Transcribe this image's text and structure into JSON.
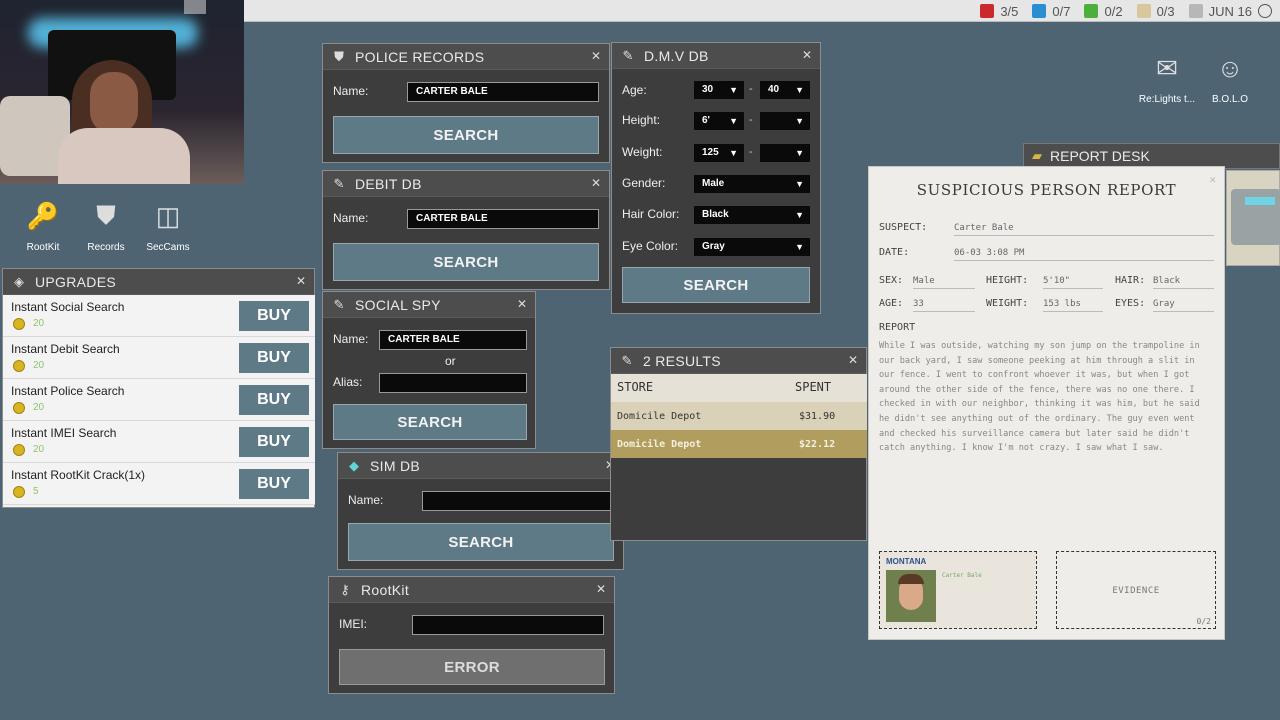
{
  "topbar": {
    "stats": [
      {
        "icon": "warrant-icon",
        "value": "3/5",
        "color": "#cc2a2a"
      },
      {
        "icon": "tablet-icon",
        "value": "0/7",
        "color": "#2b8ed1"
      },
      {
        "icon": "cash-icon",
        "value": "0/2",
        "color": "#4caf3c"
      },
      {
        "icon": "notes-icon",
        "value": "0/3",
        "color": "#d8c79a"
      },
      {
        "icon": "calendar-icon",
        "value": "JUN 16",
        "color": "#b7b7b7"
      }
    ]
  },
  "desktop": {
    "left_icons": [
      {
        "label": "RootKit",
        "icon": "usb-key-icon"
      },
      {
        "label": "Records",
        "icon": "badge-icon"
      },
      {
        "label": "SecCams",
        "icon": "camera-icon"
      }
    ],
    "right_icons": [
      {
        "label": "Re:Lights t...",
        "icon": "mail-icon"
      },
      {
        "label": "B.O.L.O",
        "icon": "bolo-icon"
      }
    ]
  },
  "upgrades": {
    "title": "UPGRADES",
    "buy_label": "BUY",
    "items": [
      {
        "name": "Instant Social Search",
        "price": "20"
      },
      {
        "name": "Instant Debit Search",
        "price": "20"
      },
      {
        "name": "Instant Police Search",
        "price": "20"
      },
      {
        "name": "Instant IMEI Search",
        "price": "20"
      },
      {
        "name": "Instant RootKit Crack(1x)",
        "price": "5"
      }
    ]
  },
  "police": {
    "title": "POLICE RECORDS",
    "name_label": "Name:",
    "name_value": "CARTER BALE",
    "button": "SEARCH"
  },
  "debit": {
    "title": "DEBIT DB",
    "name_label": "Name:",
    "name_value": "CARTER BALE",
    "button": "SEARCH"
  },
  "social": {
    "title": "SOCIAL SPY",
    "name_label": "Name:",
    "name_value": "CARTER BALE",
    "or_label": "or",
    "alias_label": "Alias:",
    "alias_value": "",
    "button": "SEARCH"
  },
  "sim": {
    "title": "SIM DB",
    "name_label": "Name:",
    "name_value": "",
    "button": "SEARCH"
  },
  "rootkit": {
    "title": "RootKit",
    "imei_label": "IMEI:",
    "imei_value": "",
    "button": "ERROR"
  },
  "dmv": {
    "title": "D.M.V DB",
    "age_label": "Age:",
    "age_min": "30",
    "age_max": "40",
    "height_label": "Height:",
    "height_min": "6'",
    "height_max": "",
    "weight_label": "Weight:",
    "weight_min": "125",
    "weight_max": "",
    "gender_label": "Gender:",
    "gender": "Male",
    "hair_label": "Hair Color:",
    "hair": "Black",
    "eye_label": "Eye Color:",
    "eye": "Gray",
    "dash": "-",
    "button": "SEARCH"
  },
  "results": {
    "title": "2 RESULTS",
    "col_store": "STORE",
    "col_spent": "SPENT",
    "rows": [
      {
        "store": "Domicile Depot",
        "spent": "$31.90"
      },
      {
        "store": "Domicile Depot",
        "spent": "$22.12"
      }
    ]
  },
  "report_desk": {
    "title": "REPORT DESK"
  },
  "report": {
    "title": "SUSPICIOUS PERSON REPORT",
    "suspect_label": "SUSPECT:",
    "suspect": "Carter Bale",
    "date_label": "DATE:",
    "date": "06-03 3:08 PM",
    "sex_label": "SEX:",
    "sex": "Male",
    "height_label": "HEIGHT:",
    "height": "5'10\"",
    "hair_label": "HAIR:",
    "hair": "Black",
    "age_label": "AGE:",
    "age": "33",
    "weight_label": "WEIGHT:",
    "weight": "153 lbs",
    "eyes_label": "EYES:",
    "eyes": "Gray",
    "report_label": "REPORT",
    "text": "While I was outside, watching my son jump on the trampoline in our back yard, I saw someone peeking at him through a slit in our fence. I went to confront whoever it was, but when I got around the other side of the fence, there was no one there. I checked in with our neighbor, thinking it was him, but he said he didn't see anything out of the ordinary. The guy even went and checked his surveillance camera but later said he didn't catch anything. I know I'm not crazy. I saw what I saw.",
    "id_state": "MONTANA",
    "id_name": "Carter Bale",
    "evidence_label": "EVIDENCE",
    "evidence_count": "0/2"
  }
}
